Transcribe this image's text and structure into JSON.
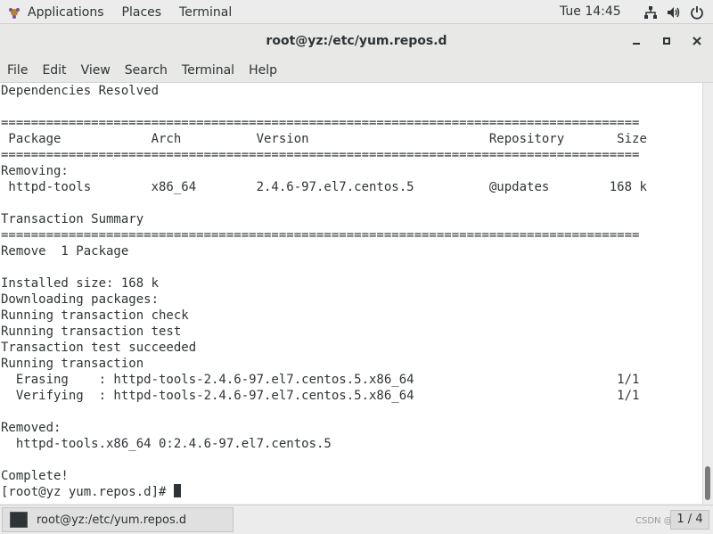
{
  "topbar": {
    "applications_label": "Applications",
    "places_label": "Places",
    "terminal_label": "Terminal",
    "clock": "Tue 14:45"
  },
  "window": {
    "title": "root@yz:/etc/yum.repos.d"
  },
  "menubar": {
    "items": [
      "File",
      "Edit",
      "View",
      "Search",
      "Terminal",
      "Help"
    ]
  },
  "terminal": {
    "lines": [
      "Dependencies Resolved",
      "",
      "=====================================================================================",
      " Package            Arch          Version                        Repository       Size",
      "=====================================================================================",
      "Removing:",
      " httpd-tools        x86_64        2.4.6-97.el7.centos.5          @updates        168 k",
      "",
      "Transaction Summary",
      "=====================================================================================",
      "Remove  1 Package",
      "",
      "Installed size: 168 k",
      "Downloading packages:",
      "Running transaction check",
      "Running transaction test",
      "Transaction test succeeded",
      "Running transaction",
      "  Erasing    : httpd-tools-2.4.6-97.el7.centos.5.x86_64                           1/1",
      "  Verifying  : httpd-tools-2.4.6-97.el7.centos.5.x86_64                           1/1",
      "",
      "Removed:",
      "  httpd-tools.x86_64 0:2.4.6-97.el7.centos.5",
      "",
      "Complete!"
    ],
    "prompt": "[root@yz yum.repos.d]# "
  },
  "taskbar": {
    "task_label": "root@yz:/etc/yum.repos.d",
    "watermark": "CSDN @it_sar",
    "pager": "1 / 4"
  }
}
